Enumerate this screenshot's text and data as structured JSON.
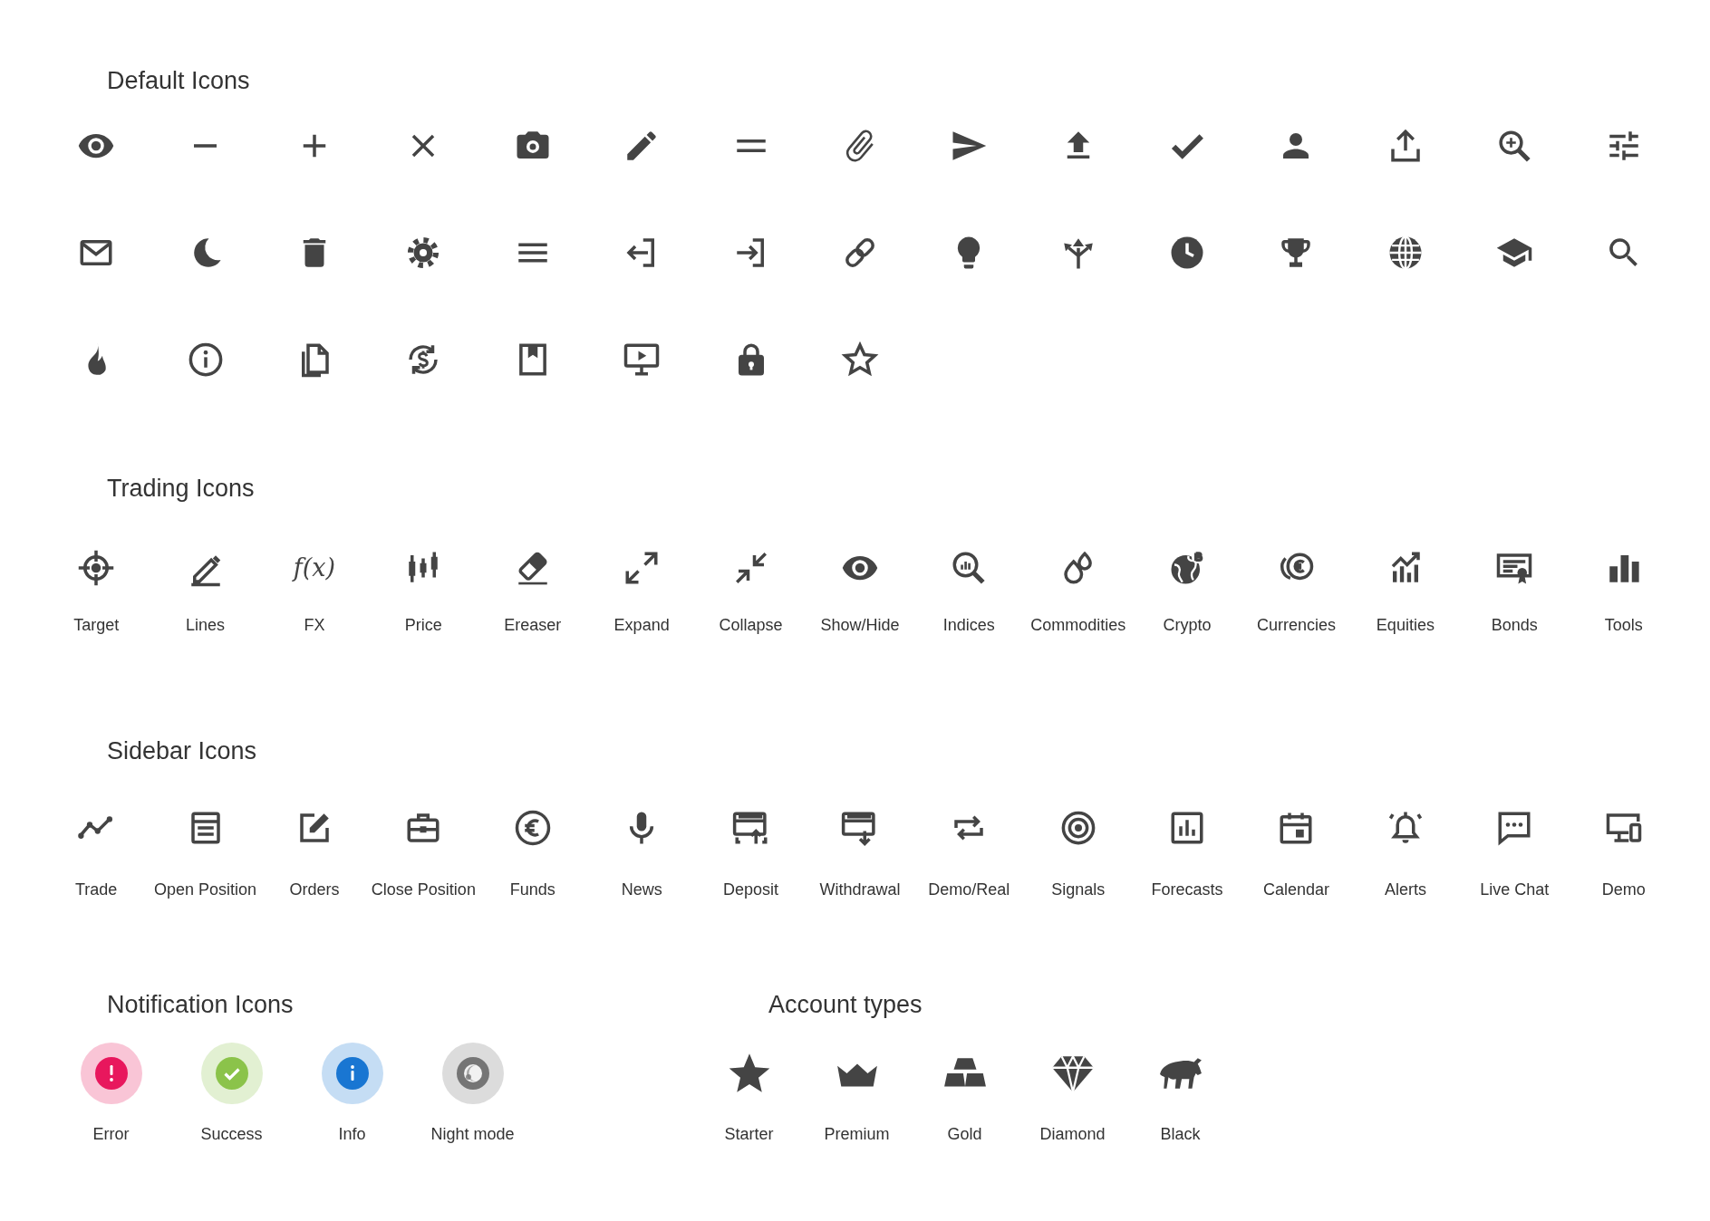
{
  "default_icons": {
    "title": "Default Icons",
    "icons": [
      {
        "kind": "eye"
      },
      {
        "kind": "minus"
      },
      {
        "kind": "plus"
      },
      {
        "kind": "close"
      },
      {
        "kind": "camera"
      },
      {
        "kind": "pencil"
      },
      {
        "kind": "equals"
      },
      {
        "kind": "paperclip"
      },
      {
        "kind": "send"
      },
      {
        "kind": "upload"
      },
      {
        "kind": "checkmark"
      },
      {
        "kind": "person"
      },
      {
        "kind": "share"
      },
      {
        "kind": "zoom-in"
      },
      {
        "kind": "sliders"
      },
      {
        "kind": "envelope"
      },
      {
        "kind": "moon"
      },
      {
        "kind": "trash"
      },
      {
        "kind": "settings"
      },
      {
        "kind": "menu"
      },
      {
        "kind": "exit"
      },
      {
        "kind": "enter"
      },
      {
        "kind": "link"
      },
      {
        "kind": "lightbulb"
      },
      {
        "kind": "split-arrows"
      },
      {
        "kind": "clock"
      },
      {
        "kind": "trophy"
      },
      {
        "kind": "globe"
      },
      {
        "kind": "graduation-cap"
      },
      {
        "kind": "search"
      },
      {
        "kind": "flame"
      },
      {
        "kind": "info"
      },
      {
        "kind": "documents"
      },
      {
        "kind": "currency-exchange"
      },
      {
        "kind": "bookmark-frame"
      },
      {
        "kind": "monitor-play"
      },
      {
        "kind": "lock"
      },
      {
        "kind": "star-outline"
      }
    ]
  },
  "trading_icons": {
    "title": "Trading Icons",
    "items": [
      {
        "kind": "crosshair",
        "label": "Target"
      },
      {
        "kind": "pencil-line",
        "label": "Lines"
      },
      {
        "kind": "fx",
        "glyph": "f(x)",
        "label": "FX"
      },
      {
        "kind": "candlestick",
        "label": "Price"
      },
      {
        "kind": "eraser",
        "label": "Ereaser"
      },
      {
        "kind": "expand",
        "label": "Expand"
      },
      {
        "kind": "collapse",
        "label": "Collapse"
      },
      {
        "kind": "eye",
        "label": "Show/Hide"
      },
      {
        "kind": "chart-search",
        "label": "Indices"
      },
      {
        "kind": "drops",
        "label": "Commodities"
      },
      {
        "kind": "crypto-globe",
        "label": "Crypto"
      },
      {
        "kind": "coins",
        "label": "Currencies"
      },
      {
        "kind": "growth-chart",
        "label": "Equities"
      },
      {
        "kind": "certificate",
        "label": "Bonds"
      },
      {
        "kind": "bar-chart",
        "label": "Tools"
      }
    ]
  },
  "sidebar_icons": {
    "title": "Sidebar Icons",
    "items": [
      {
        "kind": "line-chart",
        "label": "Trade"
      },
      {
        "kind": "document",
        "label": "Open Position"
      },
      {
        "kind": "edit",
        "label": "Orders"
      },
      {
        "kind": "briefcase",
        "label": "Close Position"
      },
      {
        "kind": "euro-coin",
        "label": "Funds"
      },
      {
        "kind": "microphone",
        "label": "News"
      },
      {
        "kind": "card-upload",
        "label": "Deposit"
      },
      {
        "kind": "card-download",
        "label": "Withdrawal"
      },
      {
        "kind": "repeat",
        "label": "Demo/Real"
      },
      {
        "kind": "target",
        "label": "Signals"
      },
      {
        "kind": "chart-box",
        "label": "Forecasts"
      },
      {
        "kind": "calendar",
        "label": "Calendar"
      },
      {
        "kind": "bell",
        "label": "Alerts"
      },
      {
        "kind": "chat",
        "label": "Live Chat"
      },
      {
        "kind": "devices",
        "label": "Demo"
      }
    ]
  },
  "notification_icons": {
    "title": "Notification Icons",
    "items": [
      {
        "kind": "alert",
        "label": "Error",
        "color": "#e8175d"
      },
      {
        "kind": "check",
        "label": "Success",
        "color": "#8bc34a"
      },
      {
        "kind": "info",
        "label": "Info",
        "color": "#1976d2"
      },
      {
        "kind": "moon",
        "label": "Night mode",
        "color": "#757575"
      }
    ]
  },
  "account_types": {
    "title": "Account types",
    "items": [
      {
        "kind": "star",
        "label": "Starter"
      },
      {
        "kind": "crown",
        "label": "Premium"
      },
      {
        "kind": "ingots",
        "label": "Gold"
      },
      {
        "kind": "diamond",
        "label": "Diamond"
      },
      {
        "kind": "bull",
        "label": "Black"
      }
    ]
  }
}
